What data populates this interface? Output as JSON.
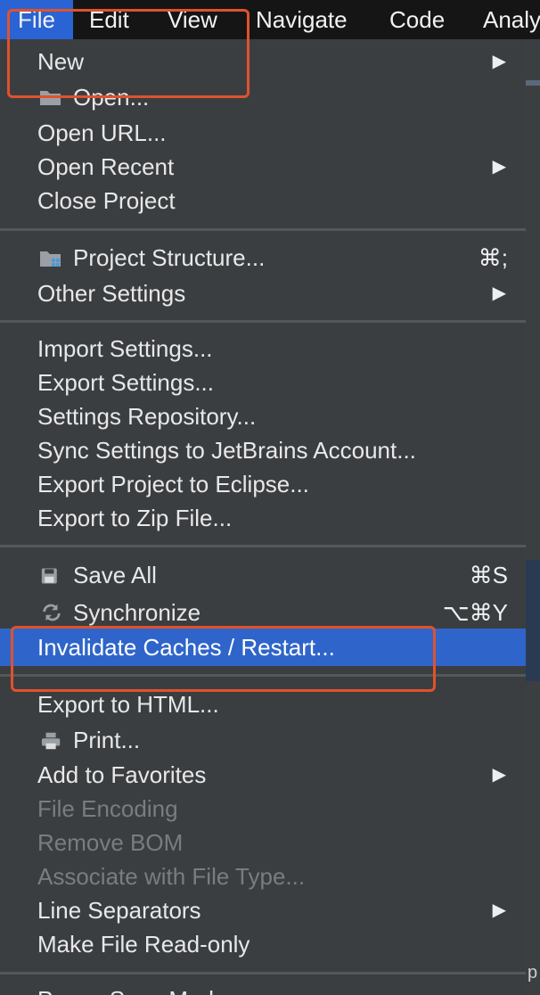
{
  "menubar": {
    "items": [
      "File",
      "Edit",
      "View",
      "Navigate",
      "Code",
      "Analy"
    ]
  },
  "menu": {
    "items": [
      {
        "label": "New",
        "submenu": true
      },
      {
        "label": "Open..."
      },
      {
        "label": "Open URL..."
      },
      {
        "label": "Open Recent",
        "submenu": true
      },
      {
        "label": "Close Project"
      },
      {
        "label": "Project Structure...",
        "shortcut": "⌘;"
      },
      {
        "label": "Other Settings",
        "submenu": true
      },
      {
        "label": "Import Settings..."
      },
      {
        "label": "Export Settings..."
      },
      {
        "label": "Settings Repository..."
      },
      {
        "label": "Sync Settings to JetBrains Account..."
      },
      {
        "label": "Export Project to Eclipse..."
      },
      {
        "label": "Export to Zip File..."
      },
      {
        "label": "Save All",
        "shortcut": "⌘S"
      },
      {
        "label": "Synchronize",
        "shortcut": "⌥⌘Y"
      },
      {
        "label": "Invalidate Caches / Restart...",
        "selected": true
      },
      {
        "label": "Export to HTML..."
      },
      {
        "label": "Print..."
      },
      {
        "label": "Add to Favorites",
        "submenu": true
      },
      {
        "label": "File Encoding",
        "disabled": true
      },
      {
        "label": "Remove BOM",
        "disabled": true
      },
      {
        "label": "Associate with File Type...",
        "disabled": true
      },
      {
        "label": "Line Separators",
        "submenu": true
      },
      {
        "label": "Make File Read-only"
      },
      {
        "label": "Power Save Mode"
      }
    ],
    "submenu_glyph": "▶"
  },
  "edge_text": "p",
  "colors": {
    "menu_bg": "#3b3e41",
    "menubar_bg": "#151515",
    "selection": "#2f65ca",
    "annotation": "#e0522c",
    "disabled_text": "#7a7d80"
  }
}
